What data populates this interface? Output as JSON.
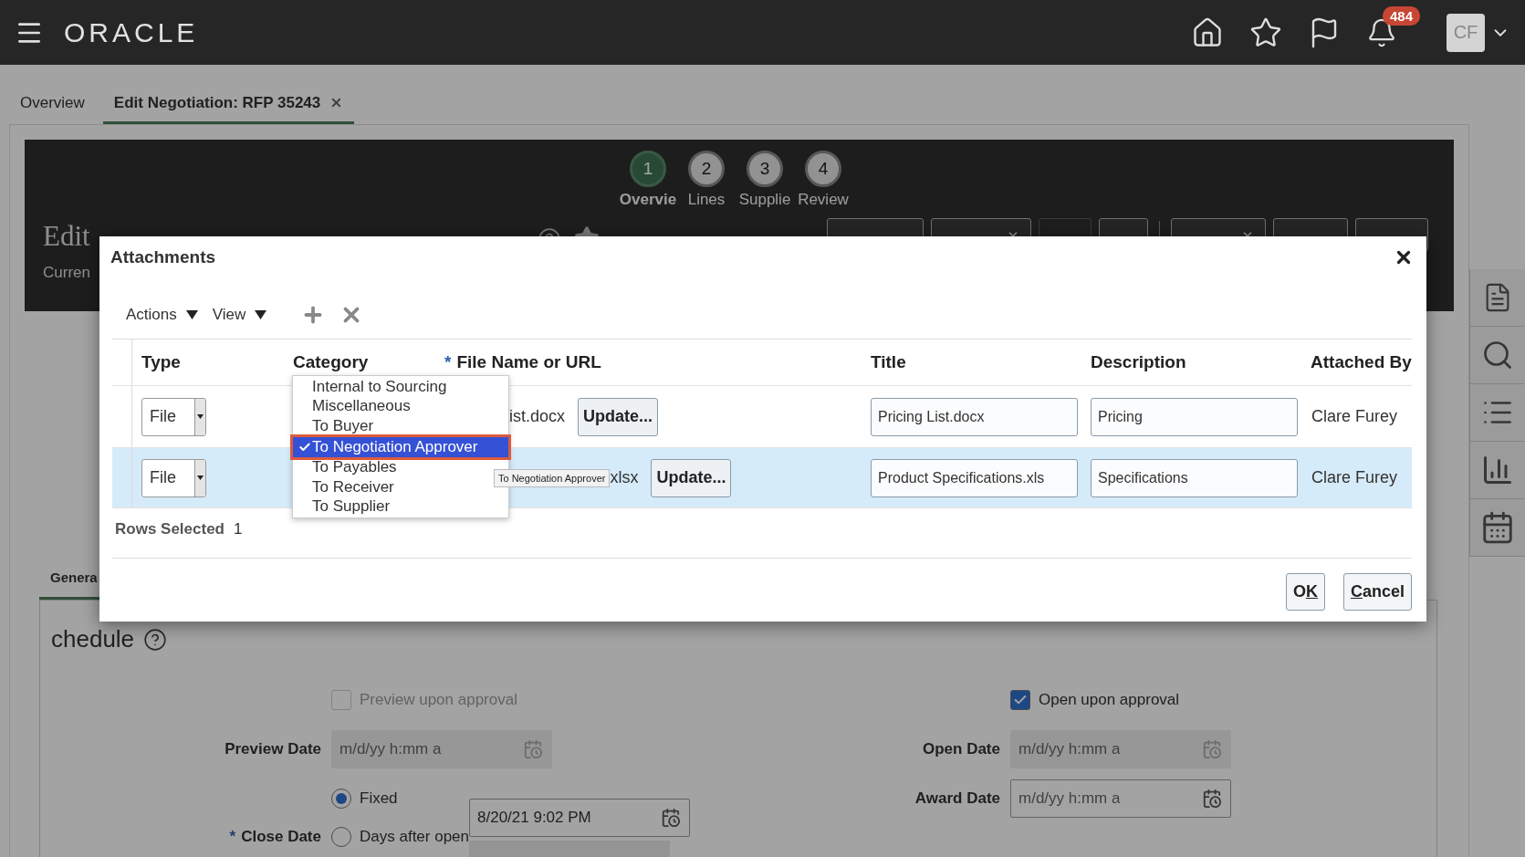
{
  "header": {
    "logo": "ORACLE",
    "notification_count": "484",
    "avatar": "CF"
  },
  "tabs": [
    {
      "label": "Overview",
      "selected": false,
      "closable": false
    },
    {
      "label": "Edit Negotiation: RFP 35243",
      "selected": true,
      "closable": true
    }
  ],
  "train": [
    {
      "number": "1",
      "label": "Overvie",
      "selected": true
    },
    {
      "number": "2",
      "label": "Lines",
      "selected": false
    },
    {
      "number": "3",
      "label": "Supplie",
      "selected": false
    },
    {
      "number": "4",
      "label": "Review",
      "selected": false
    }
  ],
  "page_title": "Edit",
  "page_buttons": [
    {
      "kind": "plain",
      "disabled": false
    },
    {
      "kind": "menu",
      "disabled": false
    },
    {
      "kind": "plain",
      "disabled": true
    },
    {
      "kind": "plain",
      "disabled": false
    },
    {
      "kind": "split",
      "disabled": false
    },
    {
      "kind": "plain",
      "disabled": false
    },
    {
      "kind": "plain",
      "disabled": false
    }
  ],
  "currency_label": "Curren",
  "section_tab": "Genera",
  "schedule": {
    "heading": "chedule",
    "preview_upon_approval": {
      "label": "Preview upon approval",
      "checked": false,
      "disabled": true
    },
    "open_upon_approval": {
      "label": "Open upon approval",
      "checked": true,
      "disabled": false
    },
    "preview_date": {
      "label": "Preview Date",
      "placeholder": "m/d/yy h:mm a",
      "disabled": true
    },
    "open_date": {
      "label": "Open Date",
      "placeholder": "m/d/yy h:mm a",
      "disabled": true
    },
    "award_date": {
      "label": "Award Date",
      "placeholder": "m/d/yy h:mm a",
      "disabled": false
    },
    "close_date": {
      "label": "Close Date",
      "marker": "*",
      "value": "8/20/21 9:02 PM",
      "options": [
        {
          "label": "Fixed",
          "selected": true
        },
        {
          "label": "Days after open",
          "selected": false
        }
      ]
    }
  },
  "dialog": {
    "title": "Attachments",
    "menus": [
      {
        "label": "Actions"
      },
      {
        "label": "View"
      }
    ],
    "columns": [
      {
        "label": "Type"
      },
      {
        "label": "Category"
      },
      {
        "label": "File Name or URL",
        "marker": "*"
      },
      {
        "label": "Title"
      },
      {
        "label": "Description"
      },
      {
        "label": "Attached By"
      }
    ],
    "rows": [
      {
        "type": "File",
        "file_name": "ist.docx",
        "update": "Update...",
        "title": "Pricing List.docx",
        "description": "Pricing",
        "attached_by": "Clare Furey",
        "selected": false
      },
      {
        "type": "File",
        "file_name": "xlsx",
        "update": "Update...",
        "title": "Product Specifications.xls",
        "description": "Specifications",
        "attached_by": "Clare Furey",
        "selected": true
      }
    ],
    "category_menu": [
      {
        "label": "Internal to Sourcing",
        "selected": false
      },
      {
        "label": "Miscellaneous",
        "selected": false
      },
      {
        "label": "To Buyer",
        "selected": false
      },
      {
        "label": "To Negotiation Approver",
        "selected": true
      },
      {
        "label": "To Payables",
        "selected": false
      },
      {
        "label": "To Receiver",
        "selected": false
      },
      {
        "label": "To Supplier",
        "selected": false
      }
    ],
    "tooltip": "To Negotiation Approver",
    "rows_selected": {
      "label": "Rows Selected",
      "count": "1"
    },
    "buttons": [
      {
        "pre": "O",
        "key": "K"
      },
      {
        "key": "C",
        "post": "ancel"
      }
    ]
  }
}
